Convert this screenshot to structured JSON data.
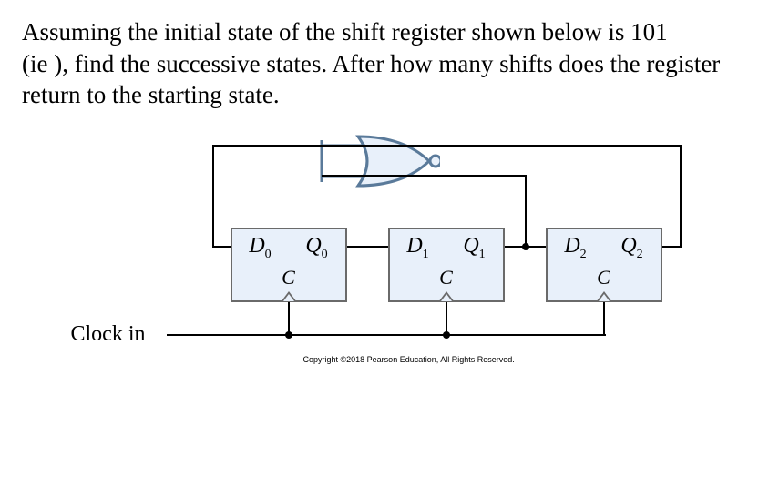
{
  "problem": {
    "line1": "Assuming the initial state of the shift register shown below is 101",
    "line2": "(ie ), find the successive states. After how many shifts does the register return to the starting state."
  },
  "flipflops": [
    {
      "d": "D",
      "dsub": "0",
      "q": "Q",
      "qsub": "0",
      "c": "C"
    },
    {
      "d": "D",
      "dsub": "1",
      "q": "Q",
      "qsub": "1",
      "c": "C"
    },
    {
      "d": "D",
      "dsub": "2",
      "q": "Q",
      "qsub": "2",
      "c": "C"
    }
  ],
  "labels": {
    "clock": "Clock in",
    "copyright": "Copyright ©2018 Pearson Education, All Rights Reserved."
  },
  "chart_data": {
    "type": "diagram",
    "description": "3-bit shift register with NOR feedback",
    "gate": {
      "kind": "NOR",
      "inputs": [
        "Q1",
        "Q2"
      ],
      "output": "D0"
    },
    "stages": [
      {
        "name": "FF0",
        "D": "D0",
        "Q": "Q0",
        "clock": "C"
      },
      {
        "name": "FF1",
        "D": "D1",
        "Q": "Q1",
        "clock": "C"
      },
      {
        "name": "FF2",
        "D": "D2",
        "Q": "Q2",
        "clock": "C"
      }
    ],
    "connections": [
      "NOR_output -> D0",
      "Q0 -> D1",
      "Q1 -> D2",
      "Q1 -> NOR_input_lower",
      "Q2 -> NOR_input_upper"
    ],
    "clock_signal": "Clock in -> C (all FFs)",
    "initial_state_Q0Q1Q2": "101"
  }
}
